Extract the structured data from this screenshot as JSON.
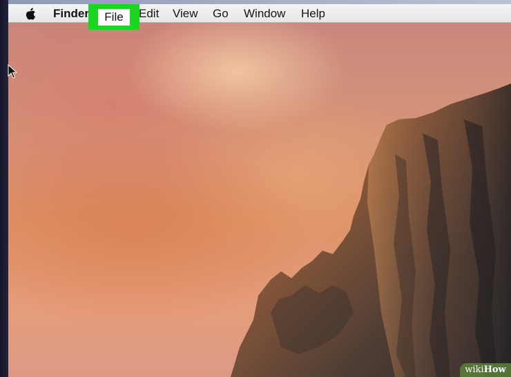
{
  "menubar": {
    "apple_menu_icon": "apple-logo-icon",
    "app_name": "Finder",
    "items": [
      "File",
      "Edit",
      "View",
      "Go",
      "Window",
      "Help"
    ],
    "highlighted_item": "File",
    "highlight_color": "#19d61e"
  },
  "desktop": {
    "wallpaper_description_colors": [
      "#c8877d",
      "#dd9267",
      "#e59c79"
    ],
    "cursor_icon": "arrow-cursor-icon"
  },
  "watermark": {
    "prefix": "wiki",
    "suffix": "How"
  }
}
